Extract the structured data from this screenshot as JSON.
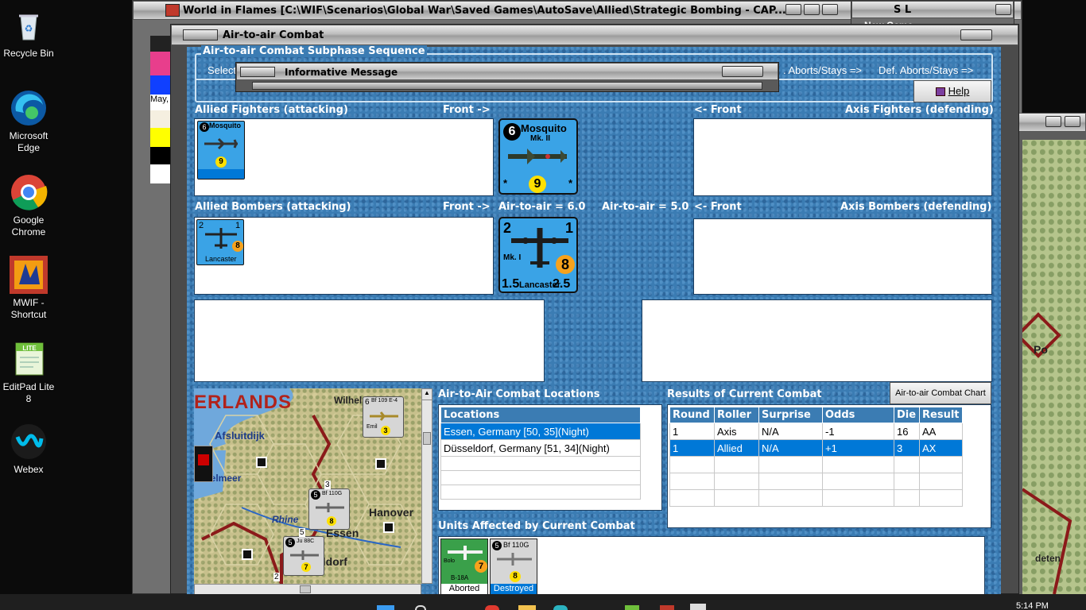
{
  "desktop": {
    "icons": [
      {
        "label": "Recycle Bin",
        "icon": "recycle-bin-icon"
      },
      {
        "label": "Microsoft Edge",
        "icon": "edge-icon"
      },
      {
        "label": "Google Chrome",
        "icon": "chrome-icon"
      },
      {
        "label": "MWIF - Shortcut",
        "icon": "mwif-icon"
      },
      {
        "label": "EditPad Lite 8",
        "icon": "editpad-icon"
      },
      {
        "label": "Webex",
        "icon": "webex-icon"
      }
    ]
  },
  "main_window": {
    "title": "World in Flames [C:\\WIF\\Scenarios\\Global War\\Saved Games\\AutoSave\\Allied\\Strategic Bombing - CAP...",
    "side_text": "May,"
  },
  "sl_window": {
    "title": "S L",
    "menu": "New Game"
  },
  "right_map": {
    "label1": "Po",
    "label2": "deten"
  },
  "dialog": {
    "title": "Air-to-air Combat",
    "subphase": {
      "title": "Air-to-air Combat Subphase Sequence",
      "select": "Select",
      "step_att": ". Aborts/Stays =>",
      "step_def": "Def. Aborts/Stays =>"
    },
    "help_label": "Help",
    "allied_fighters": {
      "label": "Allied Fighters (attacking)",
      "front": "Front ->"
    },
    "axis_fighters": {
      "label": "Axis Fighters (defending)",
      "front": "<- Front"
    },
    "allied_bombers": {
      "label": "Allied Bombers (attacking)",
      "front": "Front ->"
    },
    "axis_bombers": {
      "label": "Axis Bombers (defending)",
      "front": "<- Front"
    },
    "air_to_air_att": "Air-to-air = 6.0",
    "air_to_air_def": "Air-to-air = 5.0",
    "fighter_counter": {
      "name": "Mosquito",
      "sub": "Mk. II",
      "air": "6",
      "range": "9",
      "star": "*"
    },
    "bomber_counter": {
      "name": "Lancaster",
      "sub": "Mk. I",
      "air": "2",
      "def": "1",
      "strat": "8",
      "tac": "1.5",
      "sea": "2.5"
    },
    "locations": {
      "title": "Air-to-Air Combat Locations",
      "header": "Locations",
      "rows": [
        "Essen, Germany [50, 35](Night)",
        "Düsseldorf, Germany [51, 34](Night)"
      ]
    },
    "results": {
      "title": "Results of Current Combat",
      "chart_button": "Air-to-air Combat Chart",
      "headers": [
        "Round",
        "Roller",
        "Surprise",
        "Odds",
        "Die",
        "Result"
      ],
      "rows": [
        [
          "1",
          "Axis",
          "N/A",
          "-1",
          "16",
          "AA"
        ],
        [
          "1",
          "Allied",
          "N/A",
          "+1",
          "3",
          "AX"
        ]
      ]
    },
    "affected": {
      "title": "Units Affected by Current Combat",
      "units": [
        {
          "name": "Bolo",
          "type": "B-18A",
          "status": "Aborted",
          "val": "7"
        },
        {
          "name": "Bf 110G",
          "air": "5",
          "status": "Destroyed",
          "val": "8"
        }
      ]
    },
    "map": {
      "region": "ERLANDS",
      "places": [
        "Afsluitdijk",
        "Wilhel",
        "Rhine",
        "Essen",
        "Hanover",
        "eldorf",
        "selmeer"
      ],
      "units": [
        {
          "name": "Bf 109 E-4",
          "sub": "Emil",
          "val": "3",
          "air": "6"
        },
        {
          "name": "Bf 110G",
          "val": "8",
          "air": "5"
        },
        {
          "name": "Ju 88C",
          "val": "7",
          "air": "5"
        }
      ],
      "hex_numbers": [
        "3",
        "5",
        "2"
      ]
    }
  },
  "message": {
    "title": "Informative Message"
  },
  "taskbar": {
    "time": "5:14 PM"
  }
}
